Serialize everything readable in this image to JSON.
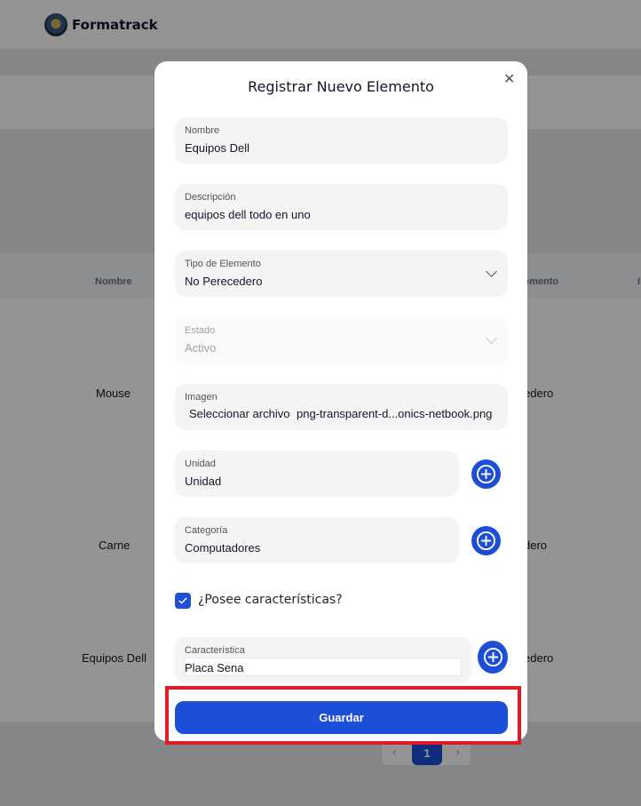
{
  "app": {
    "brand": "Formatrack"
  },
  "table": {
    "headers": {
      "name": "Nombre",
      "type_partial": "emento",
      "extra_partial": "I"
    },
    "rows": [
      {
        "name": "Mouse",
        "type_partial": "edero"
      },
      {
        "name": "Carne",
        "type_partial": "dero"
      },
      {
        "name": "Equipos Dell",
        "type_partial": "edero"
      }
    ]
  },
  "pagination": {
    "prev": "‹",
    "current": "1",
    "next": "›"
  },
  "modal": {
    "title": "Registrar Nuevo Elemento",
    "close_icon": "close-icon",
    "fields": {
      "nombre": {
        "label": "Nombre",
        "value": "Equipos Dell"
      },
      "descripcion": {
        "label": "Descripción",
        "value": "equipos dell todo en uno"
      },
      "tipo": {
        "label": "Tipo de Elemento",
        "value": "No Perecedero"
      },
      "estado": {
        "label": "Estado",
        "value": "Activo",
        "disabled": true
      },
      "imagen": {
        "label": "Imagen",
        "button": "Seleccionar archivo",
        "file_name": "png-transparent-d...onics-netbook.png"
      },
      "unidad": {
        "label": "Unidad",
        "value": "Unidad"
      },
      "categoria": {
        "label": "Categoría",
        "value": "Computadores"
      },
      "caracteristica": {
        "label": "Característica",
        "value": "Placa Sena"
      }
    },
    "has_features": {
      "label": "¿Posee características?",
      "checked": true
    },
    "save_label": "Guardar"
  },
  "colors": {
    "primary": "#1d4ed8",
    "highlight": "#e01b24",
    "field_bg": "#f4f4f5"
  }
}
